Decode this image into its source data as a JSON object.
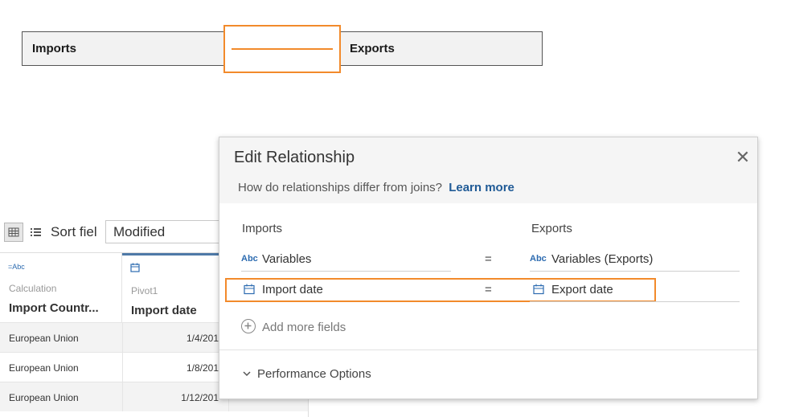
{
  "canvas": {
    "left_table": "Imports",
    "right_table": "Exports"
  },
  "toolbar": {
    "sort_label": "Sort fiel",
    "sort_value": "Modified"
  },
  "grid": {
    "columns": [
      {
        "type_icon": "=Abc",
        "source": "Calculation",
        "name": "Import Countr..."
      },
      {
        "type_icon": "calendar-icon",
        "source": "Pivot1",
        "name": "Import date"
      }
    ],
    "rows": [
      {
        "c1": "European Union",
        "c2": "1/4/201"
      },
      {
        "c1": "European Union",
        "c2": "1/8/201"
      },
      {
        "c1": "European Union",
        "c2": "1/12/201"
      }
    ]
  },
  "dialog": {
    "title": "Edit Relationship",
    "close_icon": "close-icon",
    "subtitle": "How do relationships differ from joins?",
    "learn_more": "Learn more",
    "left_header": "Imports",
    "right_header": "Exports",
    "pairs": [
      {
        "left_icon": "Abc",
        "left": "Variables",
        "op": "=",
        "right_icon": "Abc",
        "right": "Variables (Exports)"
      },
      {
        "left_icon": "calendar-icon",
        "left": "Import date",
        "op": "=",
        "right_icon": "calendar-icon",
        "right": "Export date"
      }
    ],
    "add_more": "Add more fields",
    "performance": "Performance Options"
  },
  "colors": {
    "highlight": "#f28a2b",
    "link": "#1f5a96",
    "type_icon": "#2c6bb0"
  }
}
